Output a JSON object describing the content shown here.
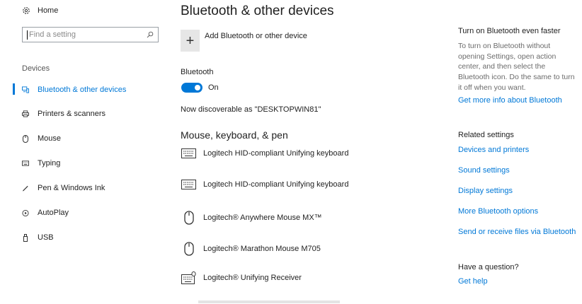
{
  "sidebar": {
    "home_label": "Home",
    "search_placeholder": "Find a setting",
    "group_label": "Devices",
    "items": [
      {
        "label": "Bluetooth & other devices",
        "icon": "bluetooth-devices-icon"
      },
      {
        "label": "Printers & scanners",
        "icon": "printer-icon"
      },
      {
        "label": "Mouse",
        "icon": "mouse-icon"
      },
      {
        "label": "Typing",
        "icon": "keyboard-icon"
      },
      {
        "label": "Pen & Windows Ink",
        "icon": "pen-icon"
      },
      {
        "label": "AutoPlay",
        "icon": "autoplay-icon"
      },
      {
        "label": "USB",
        "icon": "usb-icon"
      }
    ]
  },
  "main": {
    "title": "Bluetooth & other devices",
    "add_label": "Add Bluetooth or other device",
    "bluetooth_label": "Bluetooth",
    "toggle_state": "On",
    "discoverable": "Now discoverable as \"DESKTOPWIN81\"",
    "section_title": "Mouse, keyboard, & pen",
    "devices": [
      {
        "name": "Logitech HID-compliant Unifying keyboard",
        "icon": "keyboard-icon"
      },
      {
        "name": "Logitech HID-compliant Unifying keyboard",
        "icon": "keyboard-icon"
      },
      {
        "name": "Logitech® Anywhere Mouse MX™",
        "icon": "mouse-icon"
      },
      {
        "name": "Logitech® Marathon Mouse M705",
        "icon": "mouse-icon"
      },
      {
        "name": "Logitech® Unifying Receiver",
        "icon": "receiver-icon"
      }
    ]
  },
  "right_panel": {
    "faster_title": "Turn on Bluetooth even faster",
    "faster_desc": "To turn on Bluetooth without opening Settings, open action center, and then select the Bluetooth icon. Do the same to turn it off when you want.",
    "more_info_link": "Get more info about Bluetooth",
    "related_title": "Related settings",
    "related_links": [
      "Devices and printers",
      "Sound settings",
      "Display settings",
      "More Bluetooth options",
      "Send or receive files via Bluetooth"
    ],
    "question_title": "Have a question?",
    "help_link": "Get help"
  },
  "colors": {
    "accent": "#0078d7",
    "text": "#1f1f1f",
    "muted_text": "#6b6b6b",
    "tile": "#e6e6e6"
  }
}
